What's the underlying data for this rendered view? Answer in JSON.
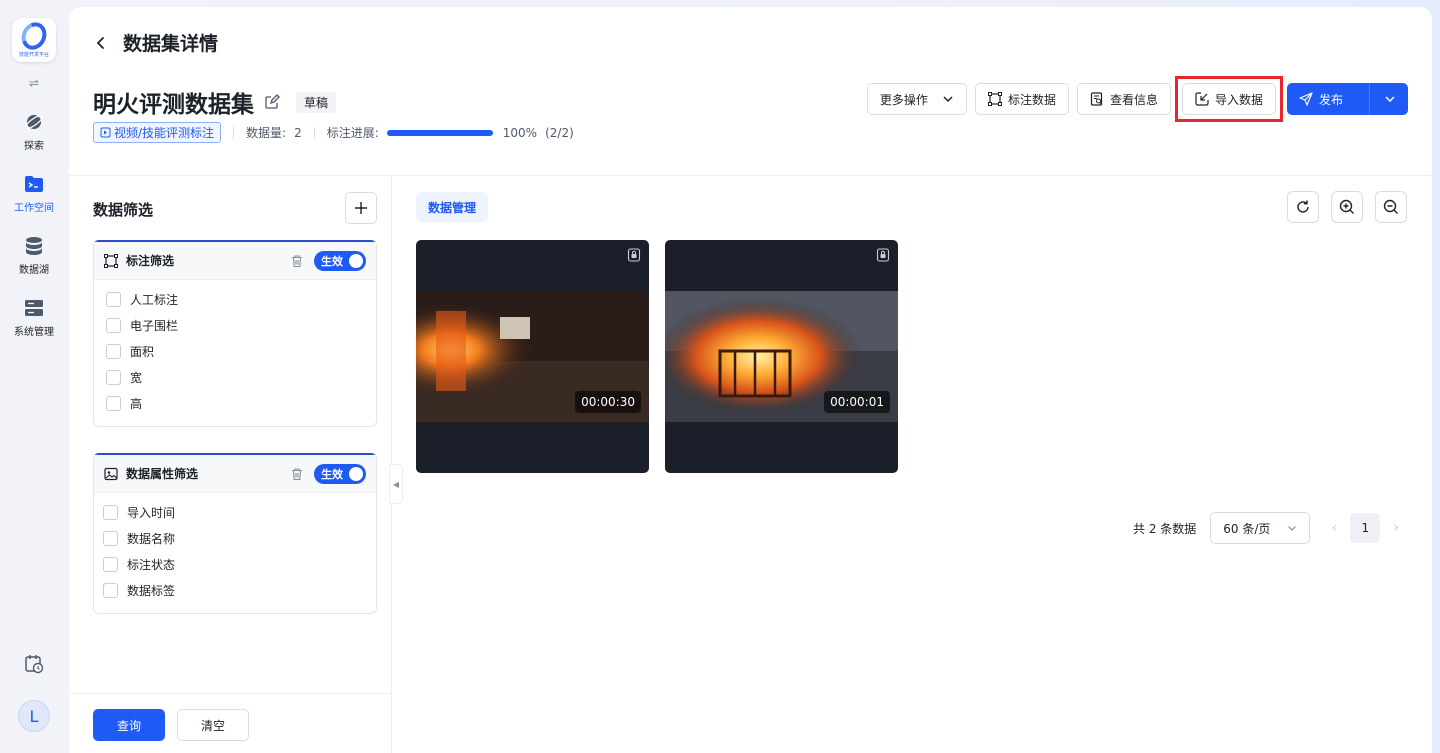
{
  "sidebar": {
    "logo_text": "技能开发平台",
    "items": [
      {
        "label": "探索",
        "icon": "planet-icon",
        "active": false
      },
      {
        "label": "工作空间",
        "icon": "folder-terminal-icon",
        "active": true
      },
      {
        "label": "数据湖",
        "icon": "database-icon",
        "active": false
      },
      {
        "label": "系统管理",
        "icon": "server-icon",
        "active": false
      }
    ],
    "avatar_letter": "L"
  },
  "header": {
    "page_title": "数据集详情"
  },
  "dataset": {
    "name": "明火评测数据集",
    "status_tag": "草稿",
    "type_tag": "视频/技能评测标注",
    "count_label": "数据量:",
    "count_value": "2",
    "progress_label": "标注进展:",
    "progress_fraction": 1.0,
    "progress_text": "100%",
    "progress_detail": "(2/2)"
  },
  "actions": {
    "more": "更多操作",
    "annotate": "标注数据",
    "view_info": "查看信息",
    "import": "导入数据",
    "publish": "发布"
  },
  "filter": {
    "title": "数据筛选",
    "groups": [
      {
        "title": "标注筛选",
        "toggle": "生效",
        "items": [
          "人工标注",
          "电子围栏",
          "面积",
          "宽",
          "高"
        ]
      },
      {
        "title": "数据属性筛选",
        "toggle": "生效",
        "items": [
          "导入时间",
          "数据名称",
          "标注状态",
          "数据标签"
        ]
      }
    ],
    "query_button": "查询",
    "clear_button": "清空"
  },
  "data_area": {
    "tab": "数据管理",
    "items": [
      {
        "duration": "00:00:30"
      },
      {
        "duration": "00:00:01"
      }
    ]
  },
  "pagination": {
    "total": "共 2 条数据",
    "page_size": "60 条/页",
    "current_page": "1"
  },
  "colors": {
    "primary": "#1f5af5",
    "highlight_border": "#e8262c"
  }
}
